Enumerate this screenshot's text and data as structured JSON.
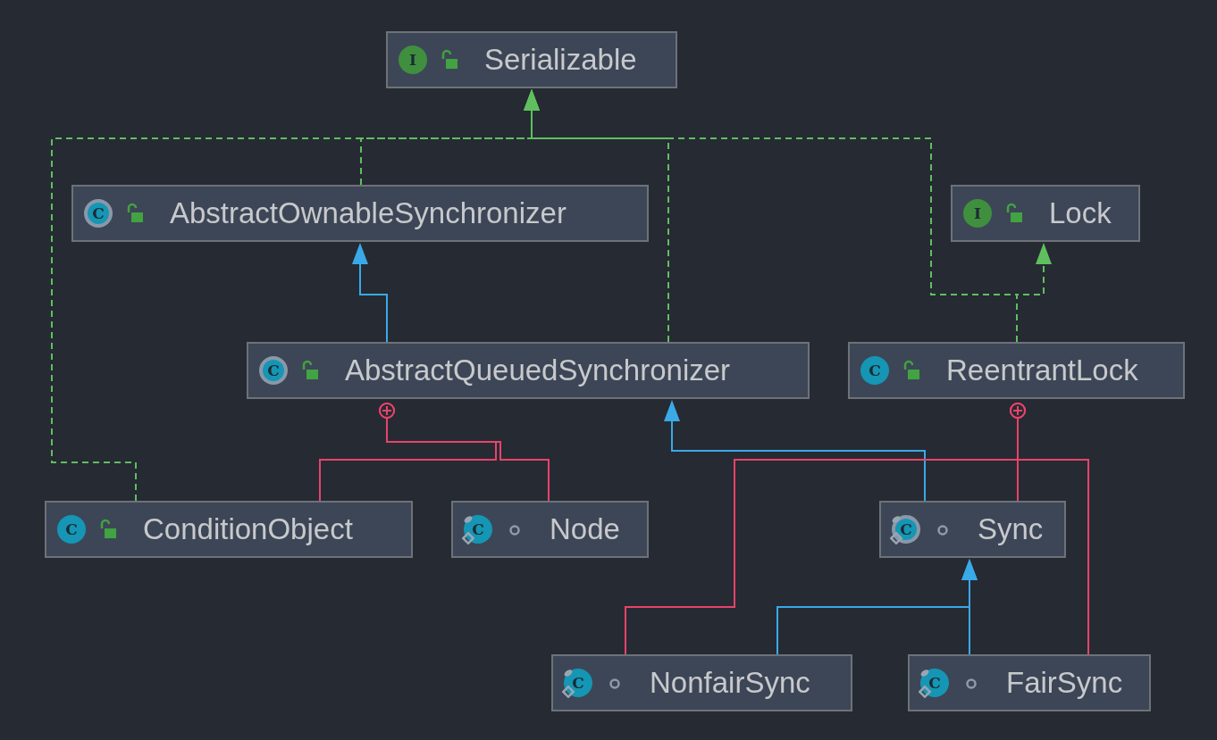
{
  "diagram": {
    "nodes": [
      {
        "name": "Serializable",
        "kind": "interface",
        "icon_letter": "I",
        "public": true,
        "static": false
      },
      {
        "name": "AbstractOwnableSynchronizer",
        "kind": "abstract",
        "icon_letter": "C",
        "public": true,
        "static": false
      },
      {
        "name": "Lock",
        "kind": "interface",
        "icon_letter": "I",
        "public": true,
        "static": false
      },
      {
        "name": "AbstractQueuedSynchronizer",
        "kind": "abstract",
        "icon_letter": "C",
        "public": true,
        "static": false
      },
      {
        "name": "ReentrantLock",
        "kind": "class",
        "icon_letter": "C",
        "public": true,
        "static": false
      },
      {
        "name": "ConditionObject",
        "kind": "class",
        "icon_letter": "C",
        "public": true,
        "static": false
      },
      {
        "name": "Node",
        "kind": "class",
        "icon_letter": "C",
        "public": false,
        "static": true
      },
      {
        "name": "Sync",
        "kind": "abstract",
        "icon_letter": "C",
        "public": false,
        "static": true
      },
      {
        "name": "NonfairSync",
        "kind": "class",
        "icon_letter": "C",
        "public": false,
        "static": true
      },
      {
        "name": "FairSync",
        "kind": "class",
        "icon_letter": "C",
        "public": false,
        "static": true
      }
    ],
    "edges": [
      {
        "kind": "implements"
      },
      {
        "kind": "implements"
      },
      {
        "kind": "implements"
      },
      {
        "kind": "implements"
      },
      {
        "kind": "implements"
      },
      {
        "kind": "extends"
      },
      {
        "kind": "extends"
      },
      {
        "kind": "extends"
      },
      {
        "kind": "extends"
      },
      {
        "kind": "inner"
      },
      {
        "kind": "inner"
      },
      {
        "kind": "inner"
      },
      {
        "kind": "inner"
      },
      {
        "kind": "inner"
      }
    ]
  }
}
